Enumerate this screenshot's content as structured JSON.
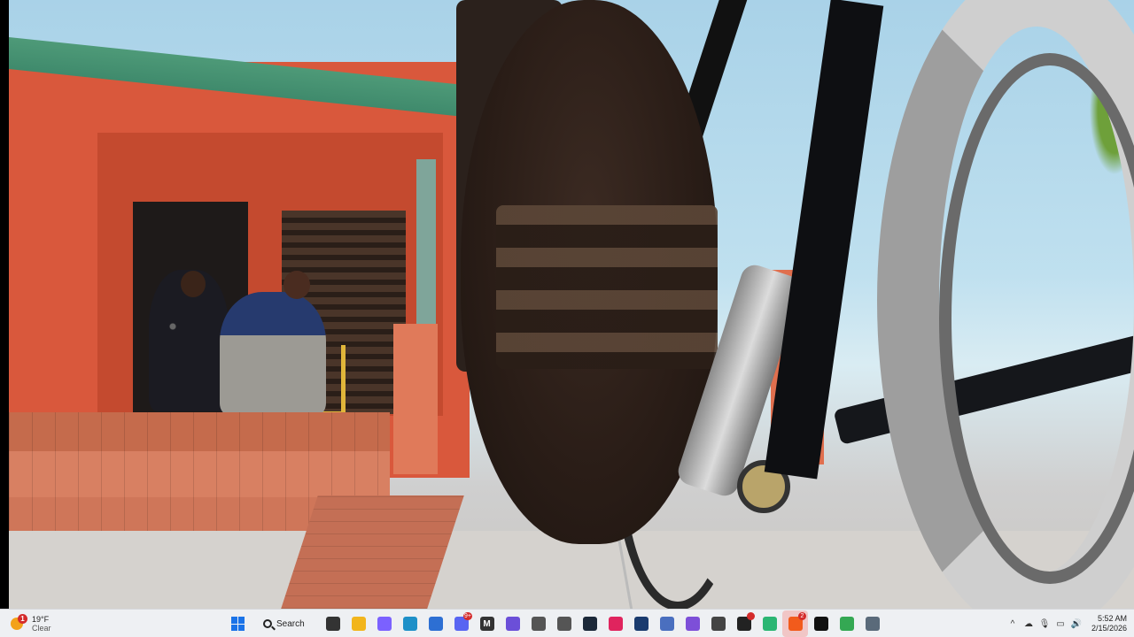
{
  "video": {
    "scene": "video-frame"
  },
  "taskbar": {
    "weather": {
      "temp": "19°F",
      "condition": "Clear",
      "badge": "1",
      "icon": "weather-sun-icon"
    },
    "search_label": "Search",
    "apps": [
      {
        "name": "start-button",
        "icon": "windows-start-icon"
      },
      {
        "name": "search-box",
        "icon": "search-icon"
      },
      {
        "name": "task-view-button",
        "icon": "task-view-icon",
        "color": "#333333"
      },
      {
        "name": "file-explorer-button",
        "icon": "folder-icon",
        "color": "#f2b51c"
      },
      {
        "name": "copilot-button",
        "icon": "copilot-icon",
        "color": "#7b61ff"
      },
      {
        "name": "edge-button",
        "icon": "edge-icon",
        "color": "#1e90c8"
      },
      {
        "name": "store-button",
        "icon": "store-icon",
        "color": "#2d6fd3"
      },
      {
        "name": "discord-button",
        "icon": "discord-icon",
        "color": "#5865f2",
        "badge": "9+"
      },
      {
        "name": "m-app-button",
        "icon": "m-logo-icon",
        "color": "#333333",
        "glyph": "M"
      },
      {
        "name": "purple-app-button",
        "icon": "purple-app-icon",
        "color": "#6b4fd8"
      },
      {
        "name": "diamond-app-button-1",
        "icon": "diamond-icon",
        "color": "#555555"
      },
      {
        "name": "diamond-app-button-2",
        "icon": "diamond-icon",
        "color": "#555555"
      },
      {
        "name": "steam-button",
        "icon": "steam-icon",
        "color": "#1b2838"
      },
      {
        "name": "tiktok-button",
        "icon": "tiktok-icon",
        "color": "#e0245e"
      },
      {
        "name": "mt-app-button",
        "icon": "mt-logo-icon",
        "color": "#1a3b6e"
      },
      {
        "name": "diamond-app-button-3",
        "icon": "diamond-icon",
        "color": "#4a6fbf"
      },
      {
        "name": "purple-app-button-2",
        "icon": "purple-app-icon",
        "color": "#7d4fd8"
      },
      {
        "name": "owl-app-button",
        "icon": "owl-icon",
        "color": "#444444"
      },
      {
        "name": "obs-button",
        "icon": "obs-icon",
        "color": "#222222",
        "badge": " "
      },
      {
        "name": "green-app-button",
        "icon": "green-app-icon",
        "color": "#2bb673"
      },
      {
        "name": "brave-button",
        "icon": "brave-icon",
        "color": "#f25b1c",
        "badge": "2",
        "active": true
      },
      {
        "name": "cinema-app-button",
        "icon": "cinema-icon",
        "color": "#111111"
      },
      {
        "name": "chrome-button",
        "icon": "chrome-icon",
        "color": "#34a853"
      },
      {
        "name": "settings-button",
        "icon": "gear-icon",
        "color": "#5a6a7a"
      }
    ],
    "tray": {
      "icons": [
        "chevron-up-icon",
        "cloud-icon",
        "microphone-icon",
        "network-icon",
        "volume-icon"
      ],
      "time": "5:52 AM",
      "date": "2/15/2026"
    }
  }
}
